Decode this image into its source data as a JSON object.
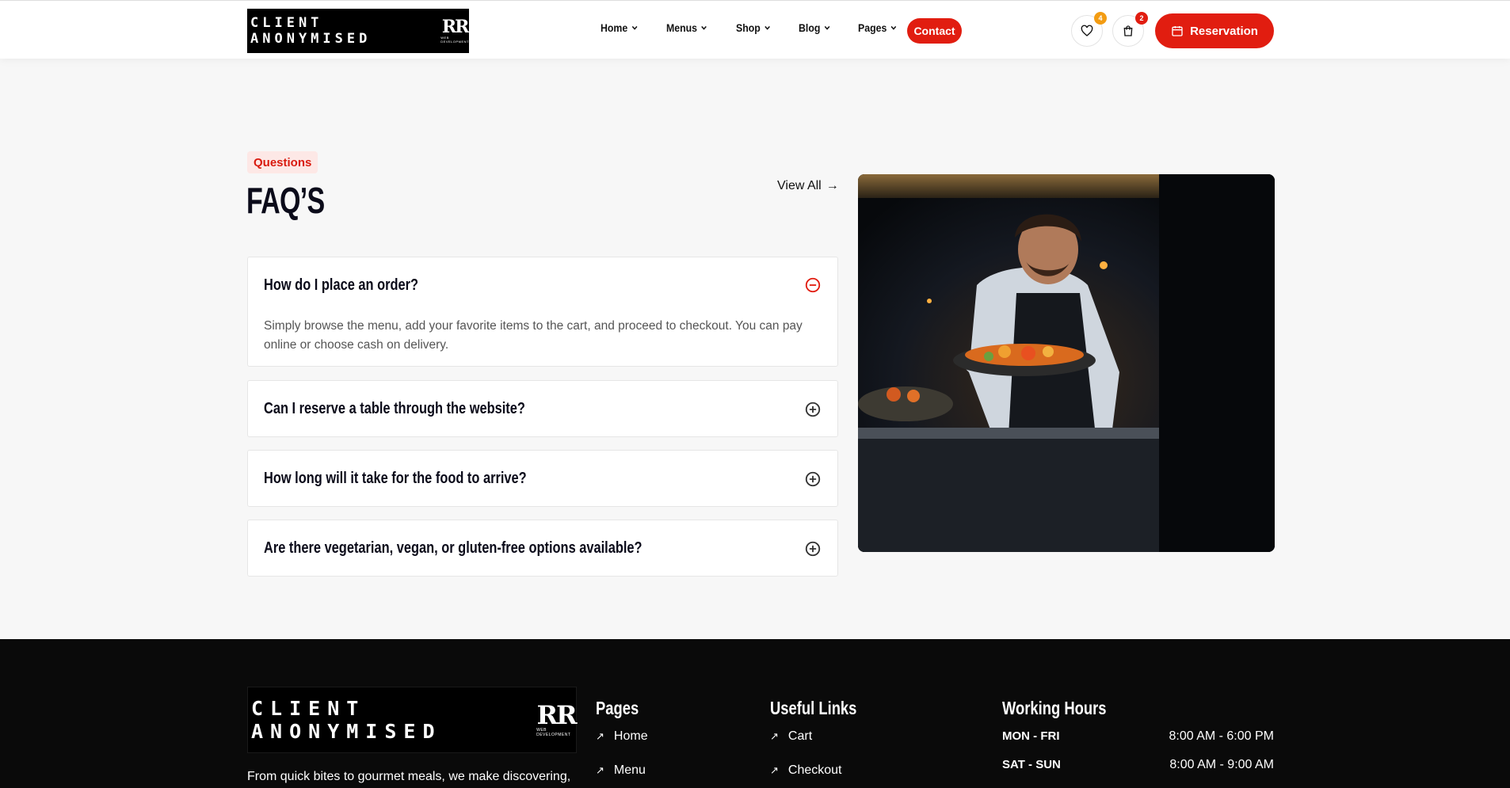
{
  "header": {
    "logo_text": "CLIENT ANONYMISED",
    "logo_mark": "RR",
    "logo_sub": "WEB DEVELOPMENT",
    "nav": [
      {
        "label": "Home"
      },
      {
        "label": "Menus"
      },
      {
        "label": "Shop"
      },
      {
        "label": "Blog"
      },
      {
        "label": "Pages"
      }
    ],
    "contact_label": "Contact",
    "wishlist_count": "4",
    "cart_count": "2",
    "reservation_label": "Reservation"
  },
  "faq": {
    "tag": "Questions",
    "title": "FAQ’S",
    "view_all": "View All",
    "items": [
      {
        "question": "How do I place an order?",
        "answer": "Simply browse the menu, add your favorite items to the cart, and proceed to checkout. You can pay online or choose cash on delivery.",
        "expanded": true
      },
      {
        "question": "Can I reserve a table through the website?",
        "expanded": false
      },
      {
        "question": "How long will it take for the food to arrive?",
        "expanded": false
      },
      {
        "question": "Are there vegetarian, vegan, or gluten-free options available?",
        "expanded": false
      }
    ]
  },
  "footer": {
    "description": "From quick bites to gourmet meals, we make discovering,",
    "pages_title": "Pages",
    "pages_links": [
      "Home",
      "Menu"
    ],
    "useful_title": "Useful Links",
    "useful_links": [
      "Cart",
      "Checkout"
    ],
    "hours_title": "Working Hours",
    "hours": [
      {
        "day": "MON - FRI",
        "time": "8:00 AM - 6:00 PM"
      },
      {
        "day": "SAT - SUN",
        "time": "8:00 AM - 9:00 AM"
      }
    ]
  },
  "colors": {
    "accent": "#e11d10",
    "wishlist_badge": "#f39c12",
    "dark": "#0b0b1a"
  }
}
